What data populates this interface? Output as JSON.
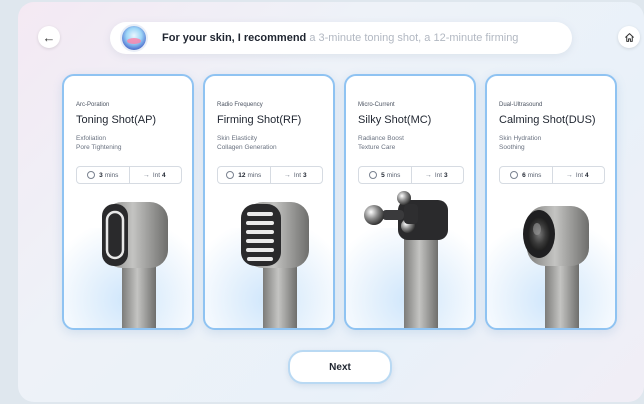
{
  "header": {
    "back_icon": "arrow-left-icon",
    "home_icon": "home-icon",
    "recommendation_bold": "For your skin, I recommend",
    "recommendation_rest": " a 3-minute toning shot, a 12-minute firming"
  },
  "cards": [
    {
      "category": "Arc-Poration",
      "title": "Toning Shot(AP)",
      "desc1": "Exfoliation",
      "desc2": "Pore Tightening",
      "time_value": "3",
      "time_unit": "mins",
      "int_label": "Int",
      "int_value": "4"
    },
    {
      "category": "Radio Frequency",
      "title": "Firming Shot(RF)",
      "desc1": "Skin Elasticity",
      "desc2": "Collagen Generation",
      "time_value": "12",
      "time_unit": "mins",
      "int_label": "Int",
      "int_value": "3"
    },
    {
      "category": "Micro-Current",
      "title": "Silky Shot(MC)",
      "desc1": "Radiance Boost",
      "desc2": "Texture Care",
      "time_value": "5",
      "time_unit": "mins",
      "int_label": "Int",
      "int_value": "3"
    },
    {
      "category": "Dual-Ultrasound",
      "title": "Calming Shot(DUS)",
      "desc1": "Skin Hydration",
      "desc2": "Soothing",
      "time_value": "6",
      "time_unit": "mins",
      "int_label": "Int",
      "int_value": "4"
    }
  ],
  "footer": {
    "next_label": "Next"
  },
  "colors": {
    "card_border": "#8fc3f2",
    "device_metal": "#9a9a98",
    "device_dark": "#2a2a2c"
  }
}
